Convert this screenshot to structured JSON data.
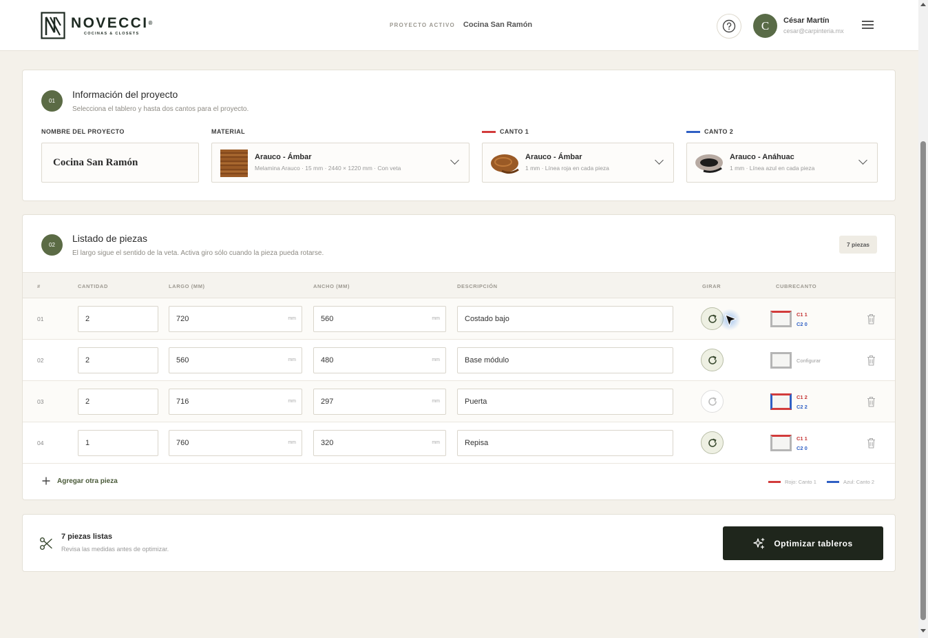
{
  "header": {
    "brand_name": "NOVECCI",
    "brand_reg": "®",
    "brand_tagline": "COCINAS & CLOSETS",
    "active_label": "PROYECTO ACTIVO",
    "active_project": "Cocina San Ramón",
    "user_initial": "C",
    "user_name": "César Martín",
    "user_email": "cesar@carpinteria.mx"
  },
  "project_info": {
    "step": "01",
    "title": "Información del proyecto",
    "subtitle": "Selecciona el tablero y hasta dos cantos para el proyecto.",
    "name_label": "NOMBRE DEL PROYECTO",
    "name_value": "Cocina San Ramón",
    "material_label": "MATERIAL",
    "material_title": "Arauco - Ámbar",
    "material_sub": "Melamina Arauco · 15 mm · 2440 × 1220 mm · Con veta",
    "canto1_label": "CANTO 1",
    "canto1_title": "Arauco - Ámbar",
    "canto1_sub": "1 mm · Línea roja en cada pieza",
    "canto2_label": "CANTO 2",
    "canto2_title": "Arauco - Anáhuac",
    "canto2_sub": "1 mm · Línea azul en cada pieza"
  },
  "pieces": {
    "step": "02",
    "title": "Listado de piezas",
    "subtitle": "El largo sigue el sentido de la veta. Activa giro sólo cuando la pieza pueda rotarse.",
    "count_chip": "7 piezas",
    "columns": {
      "num": "#",
      "qty": "CANTIDAD",
      "length": "LARGO (MM)",
      "width": "ANCHO (MM)",
      "desc": "DESCRIPCIÓN",
      "rotate": "GIRAR",
      "edge": "CUBRECANTO"
    },
    "unit": "mm",
    "rows": [
      {
        "num": "01",
        "qty": "2",
        "length": "720",
        "width": "560",
        "desc": "Costado bajo",
        "rotate": true,
        "c1": "C1 1",
        "c2": "C2 0"
      },
      {
        "num": "02",
        "qty": "2",
        "length": "560",
        "width": "480",
        "desc": "Base módulo",
        "rotate": true,
        "configure": "Configurar"
      },
      {
        "num": "03",
        "qty": "2",
        "length": "716",
        "width": "297",
        "desc": "Puerta",
        "rotate": false,
        "c1": "C1 2",
        "c2": "C2 2"
      },
      {
        "num": "04",
        "qty": "1",
        "length": "760",
        "width": "320",
        "desc": "Repisa",
        "rotate": true,
        "c1": "C1 1",
        "c2": "C2 0"
      }
    ],
    "add_label": "Agregar otra pieza",
    "legend_red": "Rojo: Canto 1",
    "legend_blue": "Azul: Canto 2"
  },
  "footer": {
    "title": "7 piezas listas",
    "subtitle": "Revisa las medidas antes de optimizar.",
    "button": "Optimizar tableros"
  },
  "colors": {
    "accent": "#5b6b45",
    "canto1": "#d23b3b",
    "canto2": "#2f5fc4",
    "button": "#1f261c"
  }
}
